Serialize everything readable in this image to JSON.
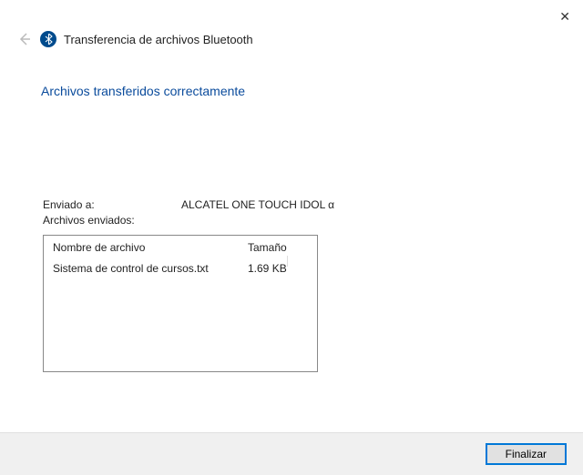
{
  "window": {
    "title": "Transferencia de archivos Bluetooth",
    "subtitle": "Archivos transferidos correctamente"
  },
  "info": {
    "sent_to_label": "Enviado a:",
    "sent_to_value": "ALCATEL ONE TOUCH IDOL α",
    "files_sent_label": "Archivos enviados:"
  },
  "table": {
    "headers": {
      "name": "Nombre de archivo",
      "size": "Tamaño"
    },
    "rows": [
      {
        "name": "Sistema de control de cursos.txt",
        "size": "1.69 KB"
      }
    ]
  },
  "buttons": {
    "finish": "Finalizar"
  }
}
